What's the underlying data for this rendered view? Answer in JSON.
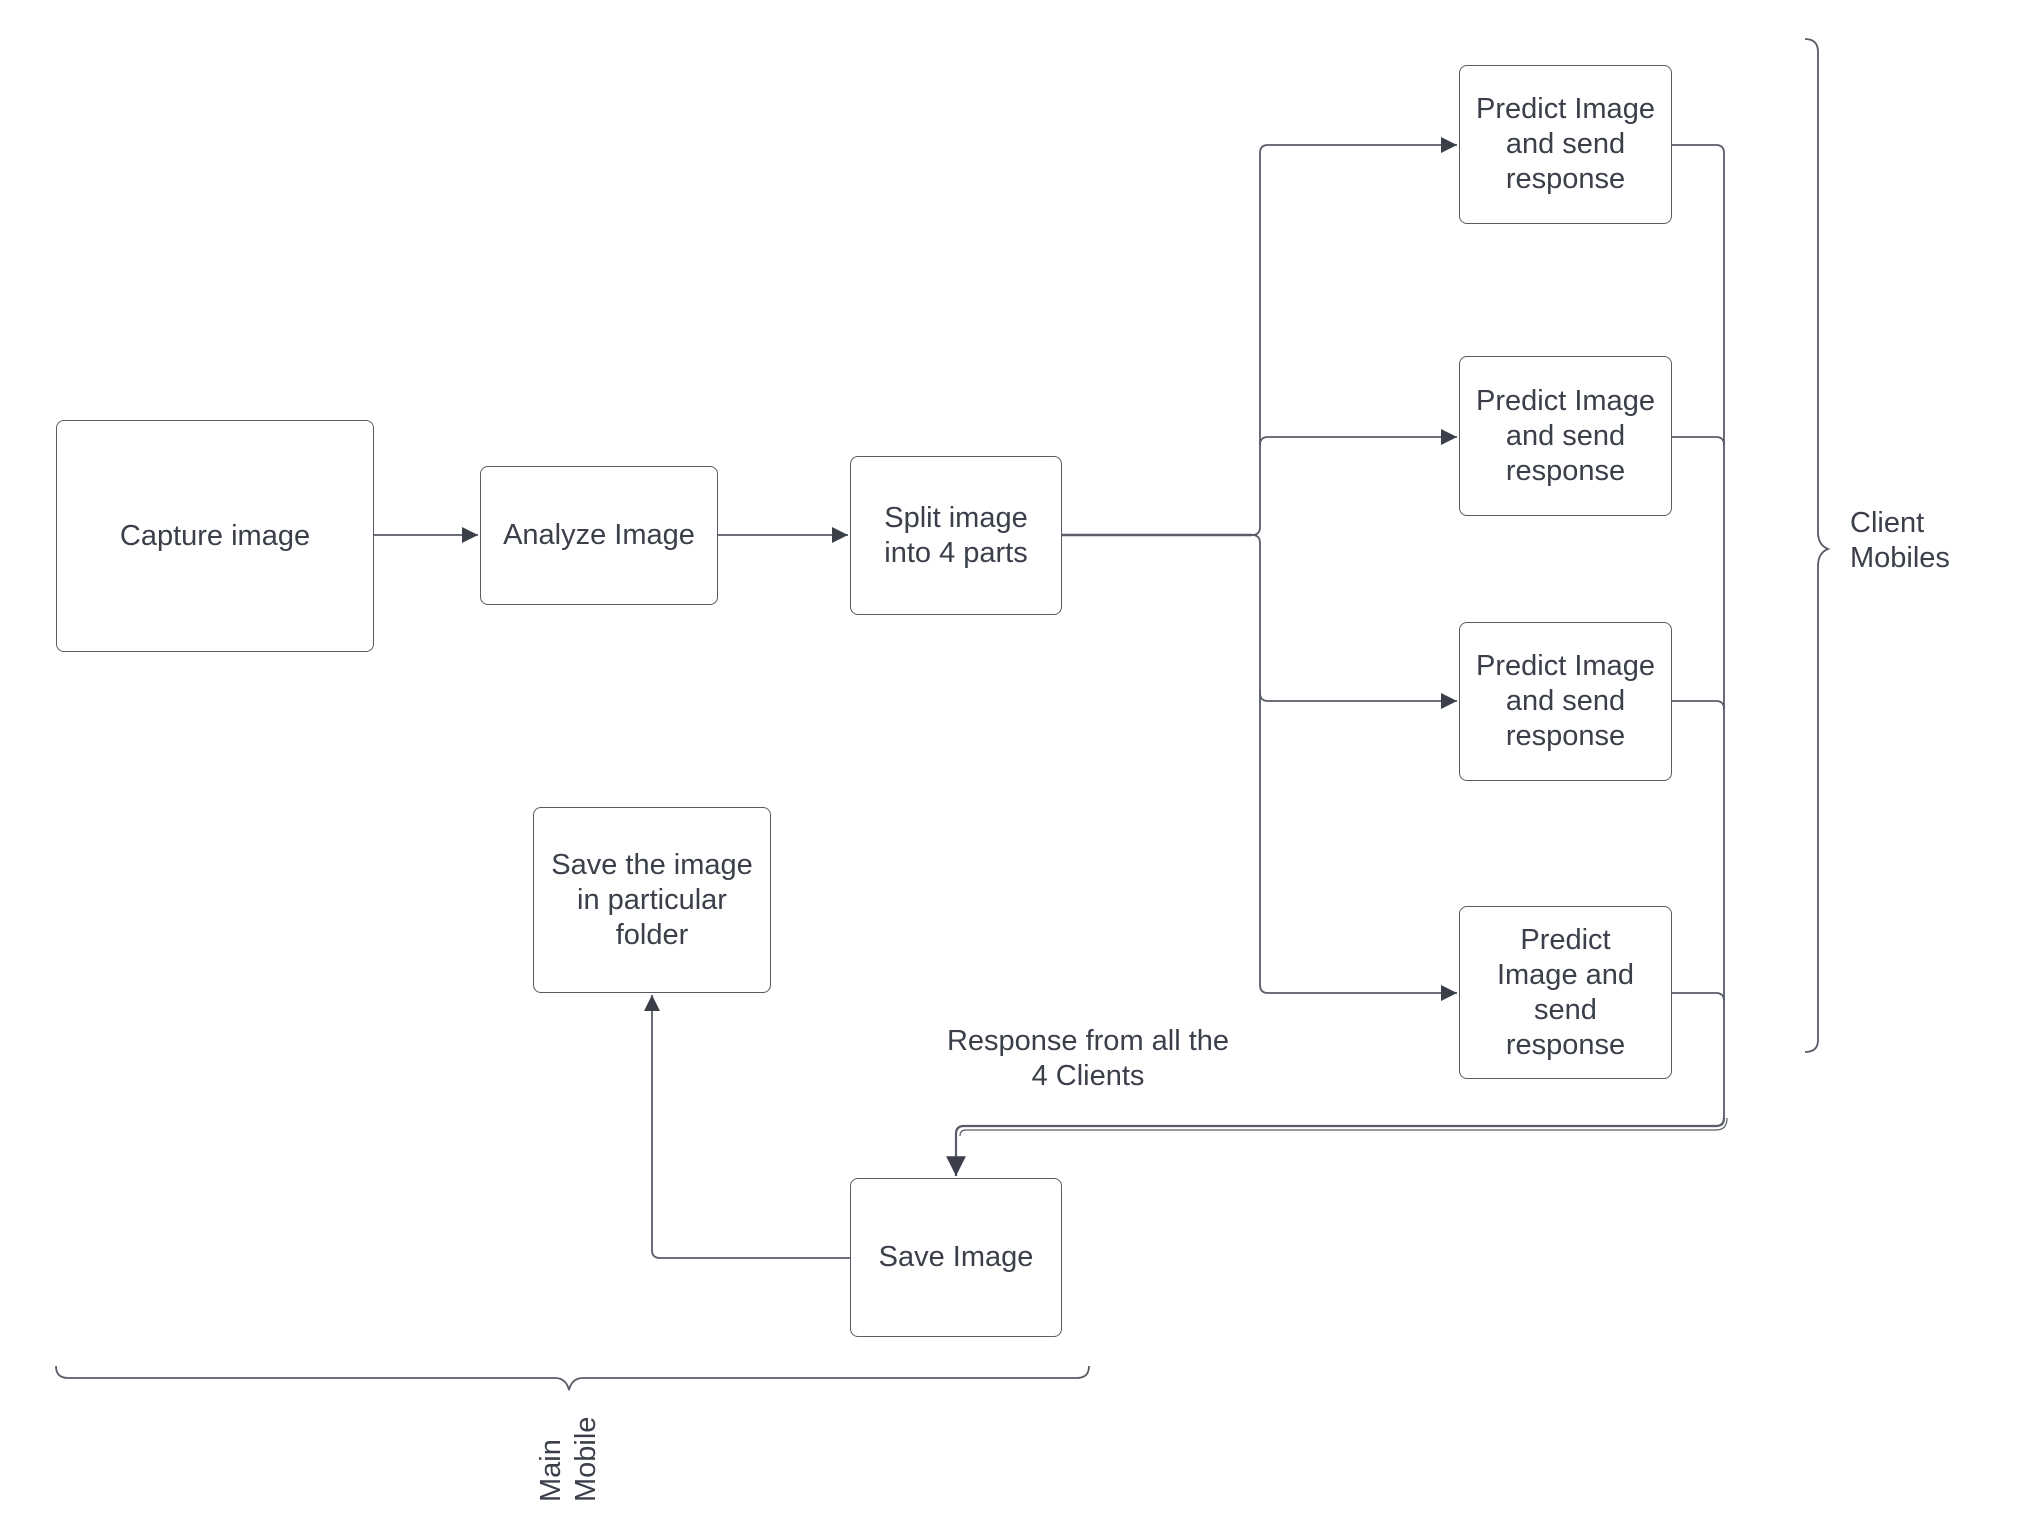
{
  "diagram": {
    "nodes": {
      "capture": "Capture image",
      "analyze": "Analyze Image",
      "split": "Split image\ninto 4 parts",
      "predict1": "Predict Image\nand send\nresponse",
      "predict2": "Predict Image\nand send\nresponse",
      "predict3": "Predict Image\nand send\nresponse",
      "predict4": "Predict\nImage and\nsend\nresponse",
      "save_folder": "Save the image\nin particular\nfolder",
      "save_image": "Save Image"
    },
    "labels": {
      "response": "Response from all the\n4 Clients",
      "client_group": "Client\nMobiles",
      "main_group": "Main\nMobile"
    },
    "edges": [
      {
        "from": "capture",
        "to": "analyze"
      },
      {
        "from": "analyze",
        "to": "split"
      },
      {
        "from": "split",
        "to": "predict1"
      },
      {
        "from": "split",
        "to": "predict2"
      },
      {
        "from": "split",
        "to": "predict3"
      },
      {
        "from": "split",
        "to": "predict4"
      },
      {
        "from": "predict1",
        "to": "save_image"
      },
      {
        "from": "predict2",
        "to": "save_image"
      },
      {
        "from": "predict3",
        "to": "save_image"
      },
      {
        "from": "predict4",
        "to": "save_image"
      },
      {
        "from": "save_image",
        "to": "save_folder"
      }
    ],
    "colors": {
      "stroke": "#585c66",
      "text": "#3a3f4a",
      "arrow": "#3a3f4a"
    }
  }
}
